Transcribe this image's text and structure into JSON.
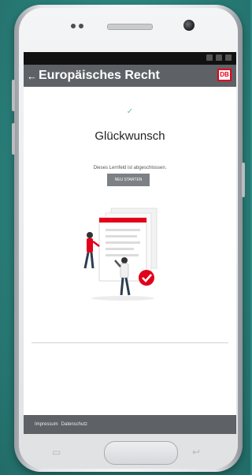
{
  "app_bar": {
    "title": "Europäisches Recht",
    "logo_text": "DB",
    "back_icon": "arrow-left-icon"
  },
  "result": {
    "check_icon": "check-icon",
    "headline": "Glückwunsch",
    "message": "Dieses Lernfeld ist abgeschlossen.",
    "restart_label": "NEU STARTEN"
  },
  "illustration": {
    "name": "completion-illustration",
    "accent_color": "#e2001a"
  },
  "footer": {
    "links": [
      "Impressum",
      "Datenschutz"
    ]
  },
  "colors": {
    "background": "#2e8b86",
    "bar": "#5e6266",
    "button": "#7d8084",
    "check": "#6abf8a"
  }
}
